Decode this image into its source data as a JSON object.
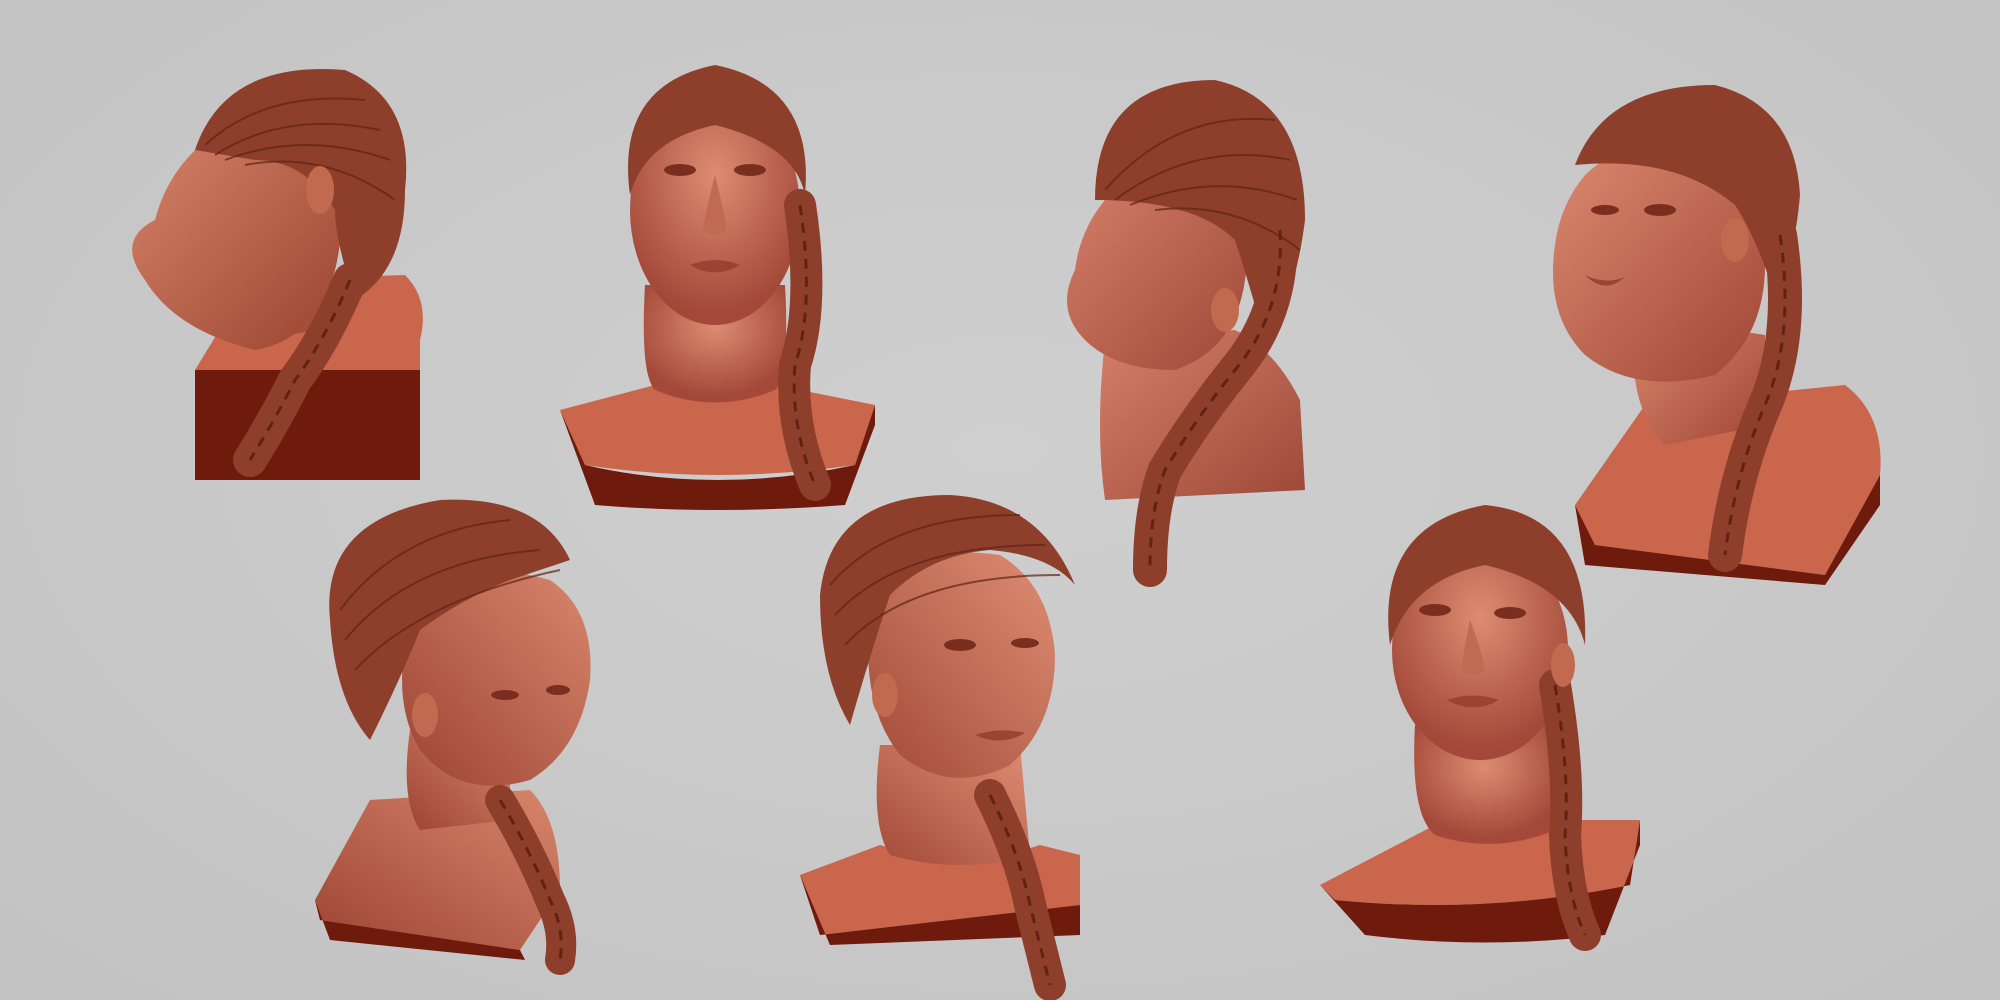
{
  "canvas": {
    "background": "#c9c9c9"
  },
  "material": {
    "clay_light": "#d07a5e",
    "clay_mid": "#b0533c",
    "clay_dark": "#7a2414",
    "hair": "#8e3f2c",
    "hair_line": "#5e2315",
    "base_top": "#c9664c",
    "base_side": "#6e1a0c"
  },
  "views": [
    {
      "name": "bust-left-profile",
      "facing": "left"
    },
    {
      "name": "bust-front-looking-up",
      "facing": "front"
    },
    {
      "name": "bust-left-three-quarter-back",
      "facing": "left"
    },
    {
      "name": "bust-left-three-quarter-upper",
      "facing": "left"
    },
    {
      "name": "bust-right-three-quarter-down",
      "facing": "right"
    },
    {
      "name": "bust-right-three-quarter",
      "facing": "right"
    },
    {
      "name": "bust-front-looking-up-lower",
      "facing": "front"
    }
  ]
}
